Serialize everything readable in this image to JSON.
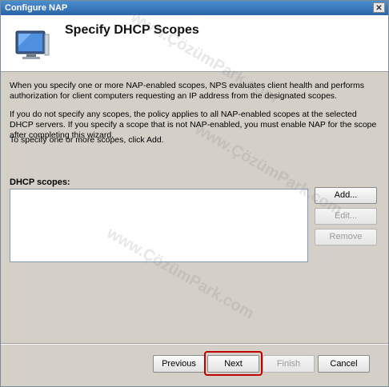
{
  "window": {
    "title": "Configure NAP",
    "close_glyph": "✕"
  },
  "header": {
    "title": "Specify DHCP Scopes",
    "icon": "monitor-icon"
  },
  "body": {
    "paragraph1": "When you specify one or more NAP-enabled scopes, NPS evaluates client health and performs authorization for client computers requesting an IP address from the designated scopes.",
    "paragraph2": "If you do not specify any scopes, the policy applies to all NAP-enabled scopes at the selected DHCP servers. If you specify a scope that is not NAP-enabled, you must enable NAP for the scope after completing this wizard.",
    "paragraph3": "To specify one or more scopes, click Add."
  },
  "scopes": {
    "label": "DHCP scopes:",
    "items": [],
    "buttons": {
      "add": "Add...",
      "edit": "Edit...",
      "remove": "Remove"
    }
  },
  "footer": {
    "previous": "Previous",
    "next": "Next",
    "finish": "Finish",
    "cancel": "Cancel"
  },
  "watermark": "www.ÇözümPark.com",
  "colors": {
    "title_bar": "#2a64a8",
    "highlight": "#c00000",
    "dialog_bg": "#d4d0c8"
  }
}
